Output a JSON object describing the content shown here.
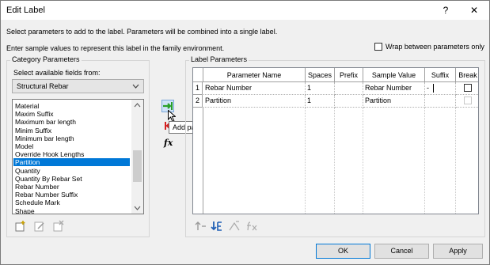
{
  "window": {
    "title": "Edit Label",
    "help_glyph": "?",
    "close_glyph": "✕"
  },
  "instructions": {
    "line1": "Select parameters to add to the label.  Parameters will be combined into a single label.",
    "line2": "Enter sample values to represent this label in the family environment."
  },
  "wrap_option": {
    "label": "Wrap between parameters only",
    "checked": false
  },
  "category_parameters": {
    "group_label": "Category Parameters",
    "select_label": "Select available fields from:",
    "selected_category": "Structural Rebar",
    "items": [
      "Material",
      "Maxim Suffix",
      "Maximum bar length",
      "Minim Suffix",
      "Minimum bar length",
      "Model",
      "Override Hook Lengths",
      "Partition",
      "Quantity",
      "Quantity By Rebar Set",
      "Rebar Number",
      "Rebar Number Suffix",
      "Schedule Mark",
      "Shape"
    ],
    "selected_item": "Partition"
  },
  "label_parameters": {
    "group_label": "Label Parameters",
    "columns": [
      "Parameter Name",
      "Spaces",
      "Prefix",
      "Sample Value",
      "Suffix",
      "Break"
    ],
    "rows": [
      {
        "num": "1",
        "name": "Rebar Number",
        "spaces": "1",
        "prefix": "",
        "sample": "Rebar Number",
        "suffix": "-",
        "break": false
      },
      {
        "num": "2",
        "name": "Partition",
        "spaces": "1",
        "prefix": "",
        "sample": "Partition",
        "suffix": "",
        "break": false
      }
    ]
  },
  "tooltip": {
    "text": "Add parameter(s) to label"
  },
  "icons": {
    "add_param": "add-parameter-icon",
    "remove_param": "remove-parameter-icon",
    "fx": "fx-icon",
    "fx_label": "fx",
    "new_param": "new-parameter-icon",
    "edit_param": "edit-parameter-icon",
    "delete_param": "delete-parameter-icon",
    "move_up": "move-up-icon",
    "move_down": "move-down-icon",
    "add_text": "format-text-icon",
    "fx_grid": "fx-parameter-icon"
  },
  "buttons": {
    "ok": "OK",
    "cancel": "Cancel",
    "apply": "Apply"
  },
  "colors": {
    "selection": "#0078d7",
    "dialog_bg": "#f0f0f0",
    "add_icon": "#2aa02a",
    "remove_icon": "#d42020"
  }
}
